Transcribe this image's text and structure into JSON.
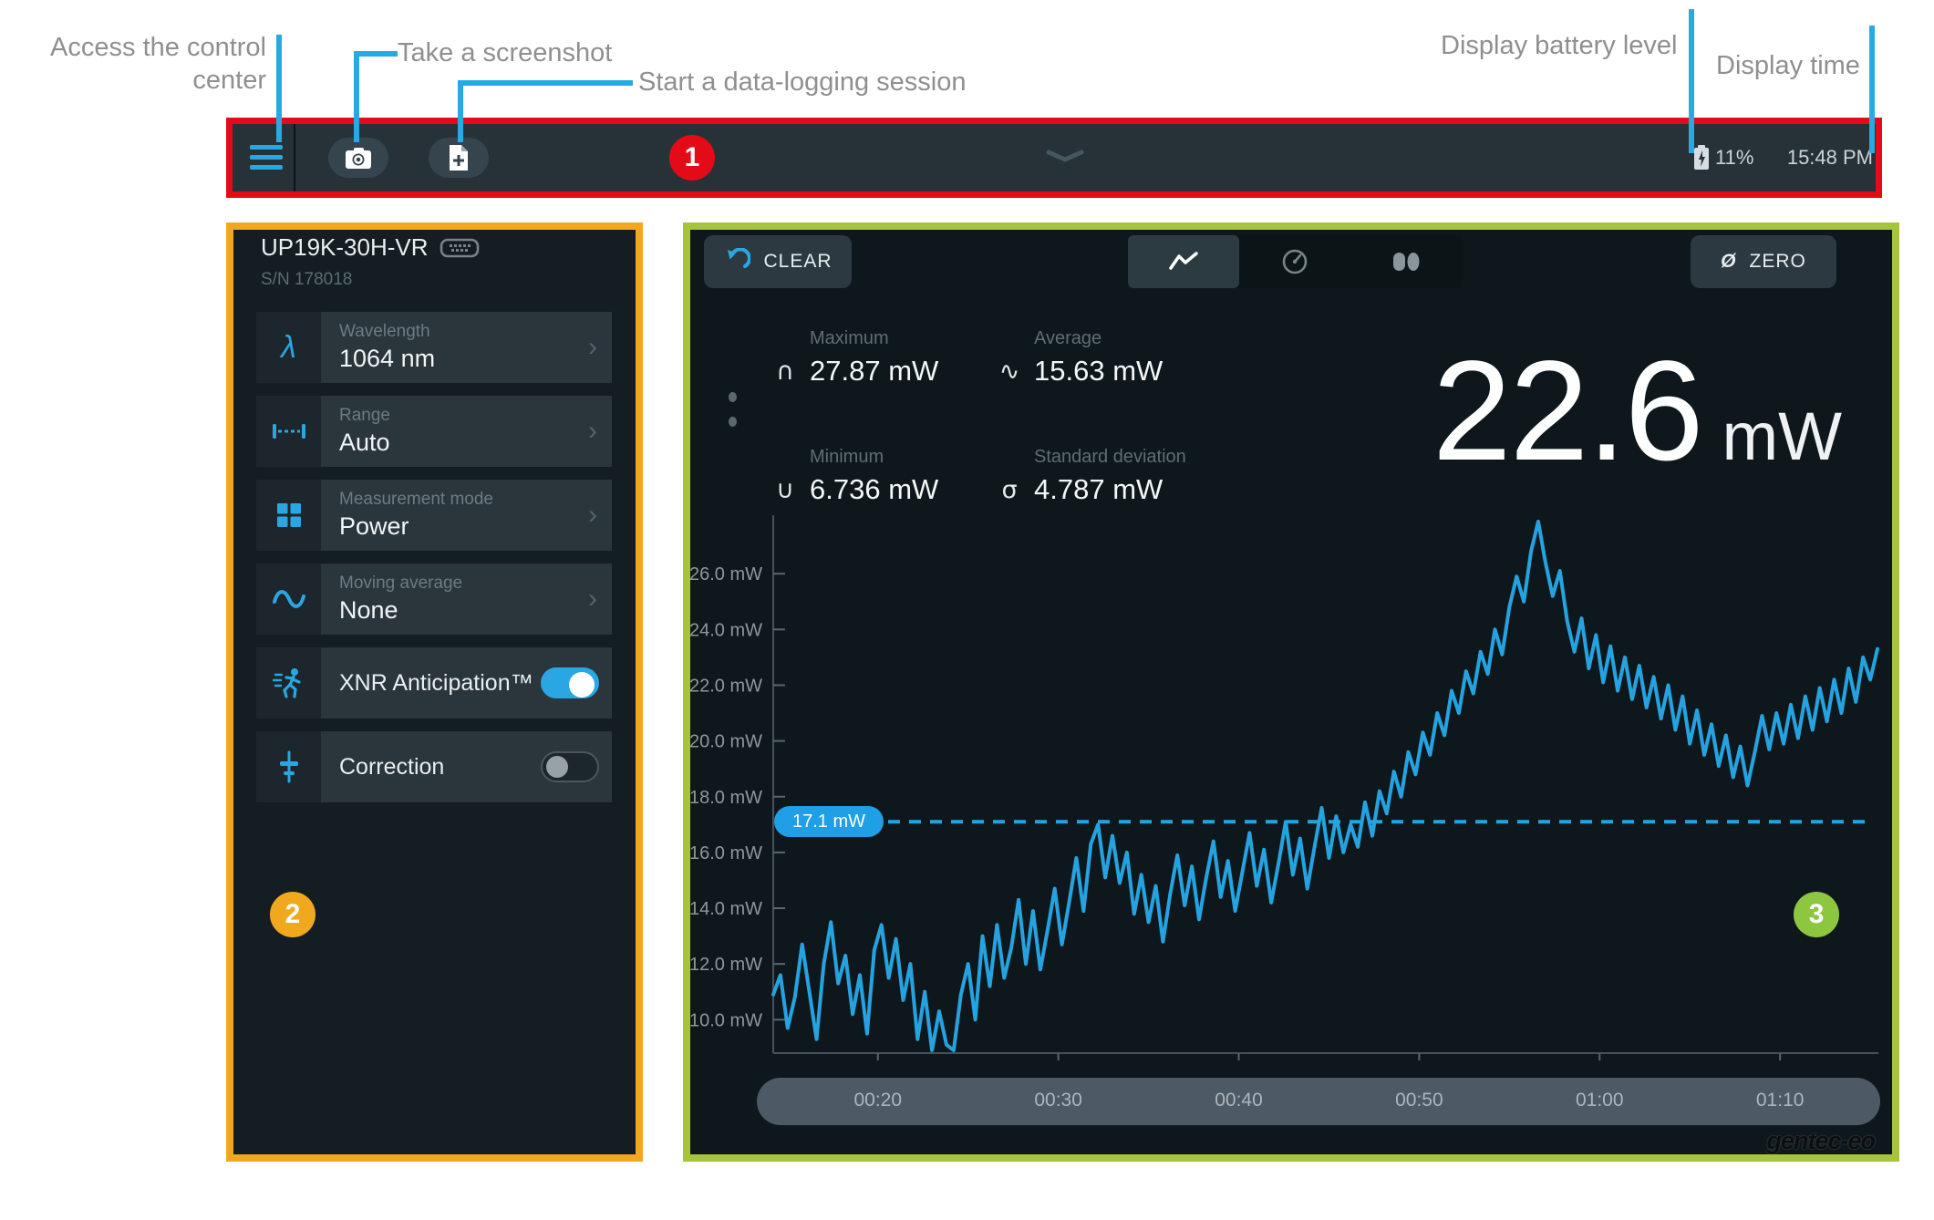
{
  "annotations": {
    "control_center": "Access the control\ncenter",
    "screenshot": "Take a screenshot",
    "datalog": "Start a data-logging session",
    "battery": "Display battery level",
    "time": "Display time",
    "callouts": {
      "one": "1",
      "two": "2",
      "three": "3"
    }
  },
  "topbar": {
    "battery_percent": "11%",
    "time": "15:48 PM"
  },
  "sidebar": {
    "device_name": "UP19K-30H-VR",
    "serial": "S/N 178018",
    "items": [
      {
        "label": "Wavelength",
        "value": "1064 nm"
      },
      {
        "label": "Range",
        "value": "Auto"
      },
      {
        "label": "Measurement mode",
        "value": "Power"
      },
      {
        "label": "Moving average",
        "value": "None"
      },
      {
        "label": "XNR Anticipation™",
        "toggle": true
      },
      {
        "label": "Correction",
        "toggle": false
      }
    ]
  },
  "main": {
    "clear_label": "CLEAR",
    "zero_label": "ZERO",
    "stats": [
      {
        "label": "Maximum",
        "value": "27.87 mW"
      },
      {
        "label": "Average",
        "value": "15.63 mW"
      },
      {
        "label": "Minimum",
        "value": "6.736 mW"
      },
      {
        "label": "Standard deviation",
        "value": "4.787 mW"
      }
    ],
    "reading": {
      "value": "22.6",
      "unit": "mW"
    },
    "threshold_label": "17.1 mW",
    "logo": "gentec-eo"
  },
  "colors": {
    "accent_blue": "#29a9e1",
    "callout_red": "#e30b17",
    "callout_amber": "#f0a81e",
    "callout_green": "#8dc63f",
    "series_blue": "#25a3e1"
  },
  "chart_data": {
    "type": "line",
    "unit": "mW",
    "yticks": [
      26,
      24,
      22,
      20,
      18,
      16,
      14,
      12,
      10
    ],
    "xticks": [
      "00:20",
      "00:30",
      "00:40",
      "00:50",
      "01:00",
      "01:10"
    ],
    "xtick_minutes": [
      20,
      30,
      40,
      50,
      60,
      70
    ],
    "ylim": [
      8.8,
      28.1
    ],
    "xlim_minutes": [
      14.2,
      75.45
    ],
    "reference_line": {
      "value": 17.1,
      "label": "17.1 mW",
      "style": "dashed"
    },
    "stats": {
      "maximum_mW": 27.87,
      "average_mW": 15.63,
      "minimum_mW": 6.736,
      "std_dev_mW": 4.787
    },
    "current_value_mW": 22.6,
    "series": [
      {
        "name": "Power",
        "color": "#25a3e1",
        "t_start": 14.2,
        "t_step": 0.4,
        "values": [
          10.9,
          11.6,
          9.7,
          10.8,
          12.7,
          11.0,
          9.3,
          12.0,
          13.5,
          11.3,
          12.3,
          10.2,
          11.6,
          9.5,
          12.5,
          13.4,
          11.5,
          12.9,
          10.7,
          12.0,
          9.3,
          11.0,
          8.9,
          10.3,
          9.1,
          8.9,
          10.9,
          12.0,
          10.0,
          13.0,
          11.2,
          13.4,
          11.5,
          12.6,
          14.3,
          12.0,
          13.9,
          11.8,
          13.2,
          14.7,
          12.7,
          14.2,
          15.8,
          13.9,
          16.3,
          17.0,
          15.1,
          16.6,
          14.9,
          16.0,
          13.8,
          15.2,
          13.5,
          14.8,
          12.8,
          14.5,
          15.9,
          14.1,
          15.5,
          13.6,
          15.1,
          16.4,
          14.4,
          15.7,
          13.9,
          15.3,
          16.7,
          14.8,
          16.1,
          14.2,
          15.6,
          17.1,
          15.2,
          16.5,
          14.7,
          16.2,
          17.6,
          15.8,
          17.3,
          16.0,
          17.0,
          16.2,
          17.8,
          16.6,
          18.2,
          17.4,
          18.9,
          18.0,
          19.6,
          18.8,
          20.3,
          19.5,
          21.0,
          20.2,
          21.8,
          21.0,
          22.5,
          21.7,
          23.2,
          22.4,
          24.0,
          23.1,
          24.8,
          25.9,
          25.0,
          26.8,
          27.87,
          26.4,
          25.2,
          26.1,
          24.3,
          23.2,
          24.4,
          22.6,
          23.8,
          22.1,
          23.4,
          21.8,
          23.0,
          21.5,
          22.7,
          21.2,
          22.3,
          20.8,
          22.0,
          20.4,
          21.6,
          19.9,
          21.1,
          19.5,
          20.6,
          19.1,
          20.2,
          18.7,
          19.8,
          18.4,
          19.6,
          20.9,
          19.7,
          21.0,
          19.9,
          21.3,
          20.1,
          21.6,
          20.4,
          21.9,
          20.7,
          22.2,
          21.0,
          22.6,
          21.4,
          23.0,
          22.2,
          23.3
        ]
      }
    ]
  }
}
